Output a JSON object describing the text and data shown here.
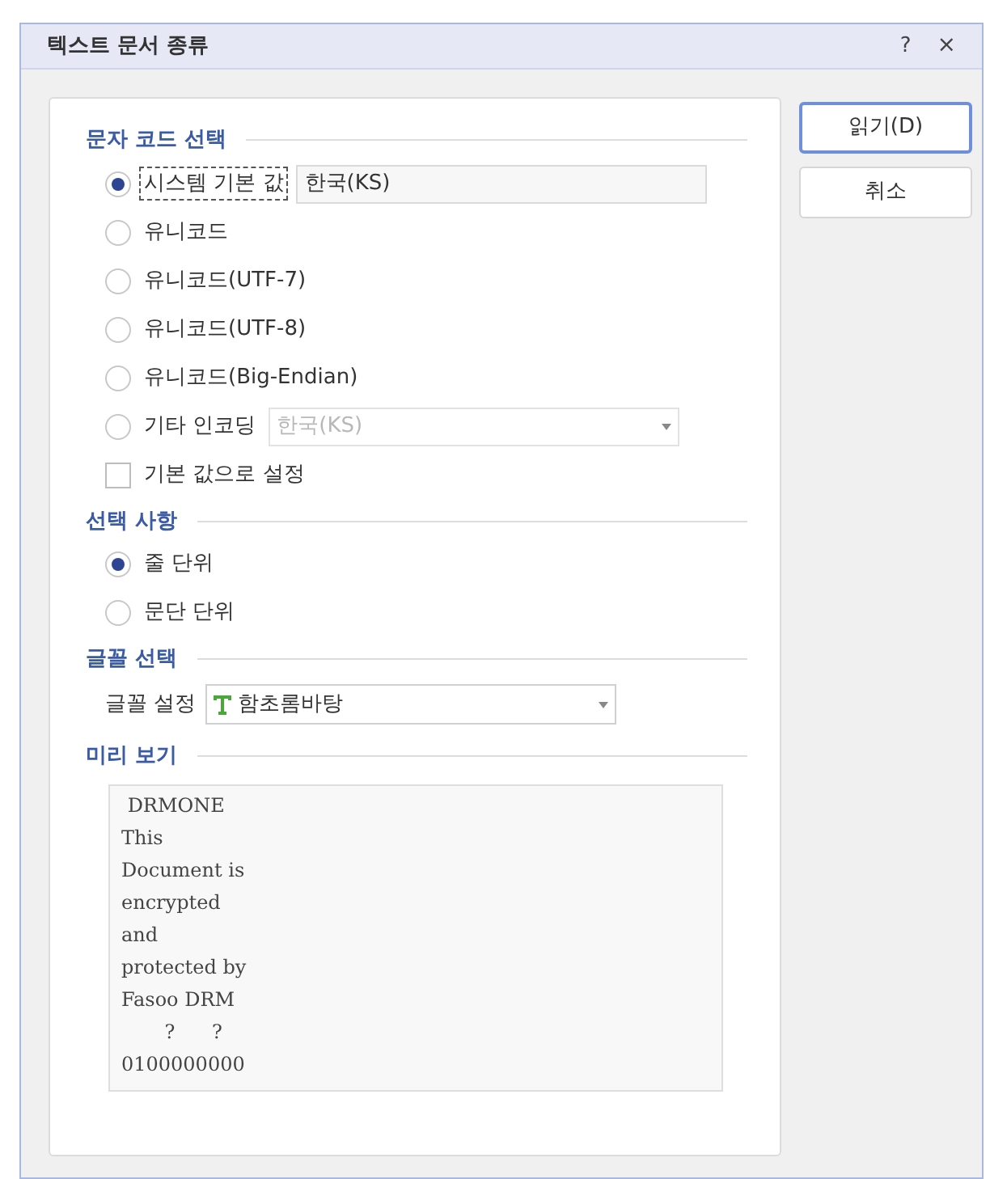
{
  "window": {
    "title": "텍스트 문서 종류",
    "help": "?",
    "close": "×"
  },
  "sections": [
    {
      "kind": "options",
      "title": "문자 코드 선택",
      "items": [
        {
          "kind": "radio",
          "label": "시스템 기본 값",
          "selected": true,
          "focused": true,
          "field": {
            "value": "한국(KS)",
            "disabled": false,
            "dropdown": false
          }
        },
        {
          "kind": "radio",
          "label": "유니코드",
          "selected": false
        },
        {
          "kind": "radio",
          "label": "유니코드(UTF-7)",
          "selected": false
        },
        {
          "kind": "radio",
          "label": "유니코드(UTF-8)",
          "selected": false
        },
        {
          "kind": "radio",
          "label": "유니코드(Big-Endian)",
          "selected": false
        },
        {
          "kind": "radio",
          "label": "기타 인코딩",
          "selected": false,
          "field": {
            "value": "한국(KS)",
            "disabled": true,
            "dropdown": true
          }
        },
        {
          "kind": "checkbox",
          "label": "기본 값으로 설정",
          "checked": false
        }
      ]
    },
    {
      "kind": "options",
      "title": "선택 사항",
      "items": [
        {
          "kind": "radio",
          "label": "줄 단위",
          "selected": true
        },
        {
          "kind": "radio",
          "label": "문단 단위",
          "selected": false
        }
      ]
    },
    {
      "kind": "font",
      "title": "글꼴 선택",
      "label": "글꼴 설정",
      "value": "함초롬바탕"
    },
    {
      "kind": "preview",
      "title": "미리 보기",
      "lines": [
        " DRMONE",
        "This",
        "Document is",
        "encrypted",
        "and",
        "protected by",
        "Fasoo DRM",
        "       ?      ?",
        "0100000000"
      ]
    }
  ],
  "buttons": [
    {
      "label": "읽기(D)",
      "default": true
    },
    {
      "label": "취소",
      "default": false
    }
  ]
}
